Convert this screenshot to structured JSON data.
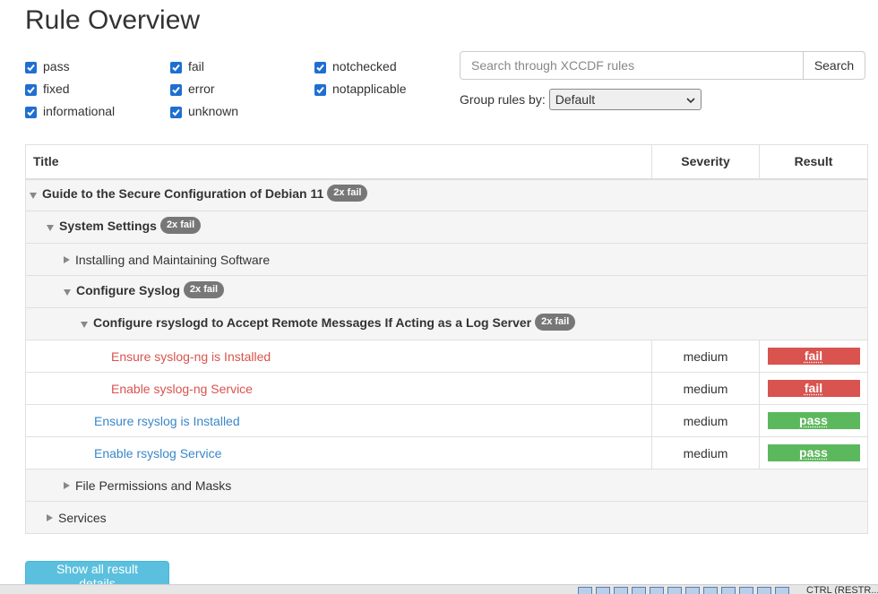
{
  "page": {
    "title": "Rule Overview"
  },
  "filters": [
    {
      "label": "pass",
      "checked": true
    },
    {
      "label": "fixed",
      "checked": true
    },
    {
      "label": "informational",
      "checked": true
    },
    {
      "label": "fail",
      "checked": true
    },
    {
      "label": "error",
      "checked": true
    },
    {
      "label": "unknown",
      "checked": true
    },
    {
      "label": "notchecked",
      "checked": true
    },
    {
      "label": "notapplicable",
      "checked": true
    }
  ],
  "search": {
    "placeholder": "Search through XCCDF rules",
    "button_label": "Search"
  },
  "grouping": {
    "label": "Group rules by:",
    "selected": "Default"
  },
  "table": {
    "headers": {
      "title": "Title",
      "severity": "Severity",
      "result": "Result"
    },
    "rows": [
      {
        "type": "group",
        "expanded": true,
        "bold": true,
        "title": "Guide to the Secure Configuration of Debian 11",
        "badge": "2x fail"
      },
      {
        "type": "group",
        "expanded": true,
        "bold": true,
        "title": "System Settings",
        "badge": "2x fail"
      },
      {
        "type": "group",
        "expanded": false,
        "bold": false,
        "title": "Installing and Maintaining Software",
        "badge": ""
      },
      {
        "type": "group",
        "expanded": true,
        "bold": true,
        "title": "Configure Syslog",
        "badge": "2x fail"
      },
      {
        "type": "group",
        "expanded": true,
        "bold": true,
        "title": "Configure rsyslogd to Accept Remote Messages If Acting as a Log Server",
        "badge": "2x fail"
      },
      {
        "type": "rule",
        "title": "Ensure syslog-ng is Installed",
        "severity": "medium",
        "result": "fail"
      },
      {
        "type": "rule",
        "title": "Enable syslog-ng Service",
        "severity": "medium",
        "result": "fail"
      },
      {
        "type": "rule",
        "title": "Ensure rsyslog is Installed",
        "severity": "medium",
        "result": "pass"
      },
      {
        "type": "rule",
        "title": "Enable rsyslog Service",
        "severity": "medium",
        "result": "pass"
      },
      {
        "type": "group",
        "expanded": false,
        "bold": false,
        "title": "File Permissions and Masks",
        "badge": ""
      },
      {
        "type": "group",
        "expanded": false,
        "bold": false,
        "title": "Services",
        "badge": ""
      }
    ]
  },
  "actions": {
    "show_all_label": "Show all result details"
  },
  "statusbar": {
    "text": "CTRL (RESTR..."
  }
}
